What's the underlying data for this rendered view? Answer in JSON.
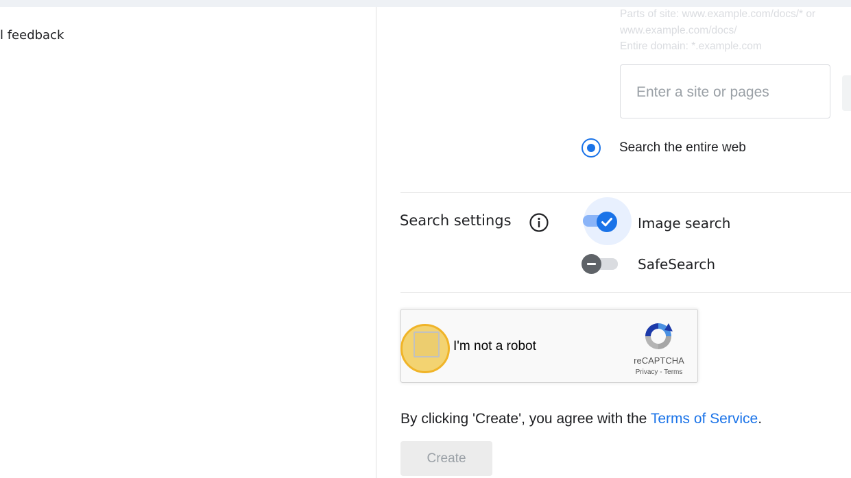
{
  "left_panel": {
    "feedback_label": "l feedback"
  },
  "sites_section": {
    "hint_lines": [
      "Parts of site: www.example.com/docs/* or",
      "www.example.com/docs/",
      "Entire domain: *.example.com"
    ],
    "site_input_placeholder": "Enter a site or pages",
    "radio_label": "Search the entire web",
    "radio_selected": true
  },
  "search_settings": {
    "title": "Search settings",
    "info_icon": "info-circle-icon",
    "toggles": [
      {
        "label": "Image search",
        "on": true,
        "icon": "check-icon"
      },
      {
        "label": "SafeSearch",
        "on": false,
        "icon": "minus-icon"
      }
    ]
  },
  "captcha": {
    "label": "I'm not a robot",
    "brand": "reCAPTCHA",
    "privacy": "Privacy",
    "separator": " - ",
    "terms": "Terms",
    "checked": false
  },
  "agreement": {
    "prefix": "By clicking 'Create', you agree with the ",
    "link": "Terms of Service",
    "suffix": "."
  },
  "create_button": {
    "label": "Create",
    "enabled": false
  },
  "colors": {
    "accent": "#1a73e8",
    "highlight": "#f0c43c",
    "toggle_track_on": "#8ab4f8",
    "toggle_off_thumb": "#5f6368"
  }
}
